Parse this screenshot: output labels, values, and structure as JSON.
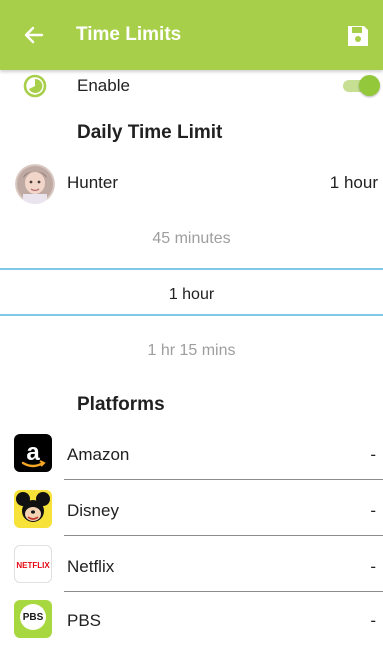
{
  "header": {
    "title": "Time Limits",
    "colors": {
      "bar": "#a8cf4a",
      "text": "#ffffff"
    }
  },
  "enable": {
    "label": "Enable",
    "toggle_on": true,
    "accent": "#93c83a"
  },
  "daily": {
    "section_title": "Daily Time Limit",
    "child": {
      "name": "Hunter",
      "value": "1 hour"
    },
    "picker": {
      "options": [
        "45 minutes",
        "1 hour",
        "1 hr 15 mins"
      ],
      "selected": "1 hour"
    }
  },
  "platforms": {
    "section_title": "Platforms",
    "items": [
      {
        "name": "Amazon",
        "value": "-",
        "icon": "amazon-icon"
      },
      {
        "name": "Disney",
        "value": "-",
        "icon": "disney-icon"
      },
      {
        "name": "Netflix",
        "value": "-",
        "icon": "netflix-icon",
        "icon_text": "NETFLIX"
      },
      {
        "name": "PBS",
        "value": "-",
        "icon": "pbs-kids-icon",
        "icon_text": "PBS"
      }
    ]
  }
}
